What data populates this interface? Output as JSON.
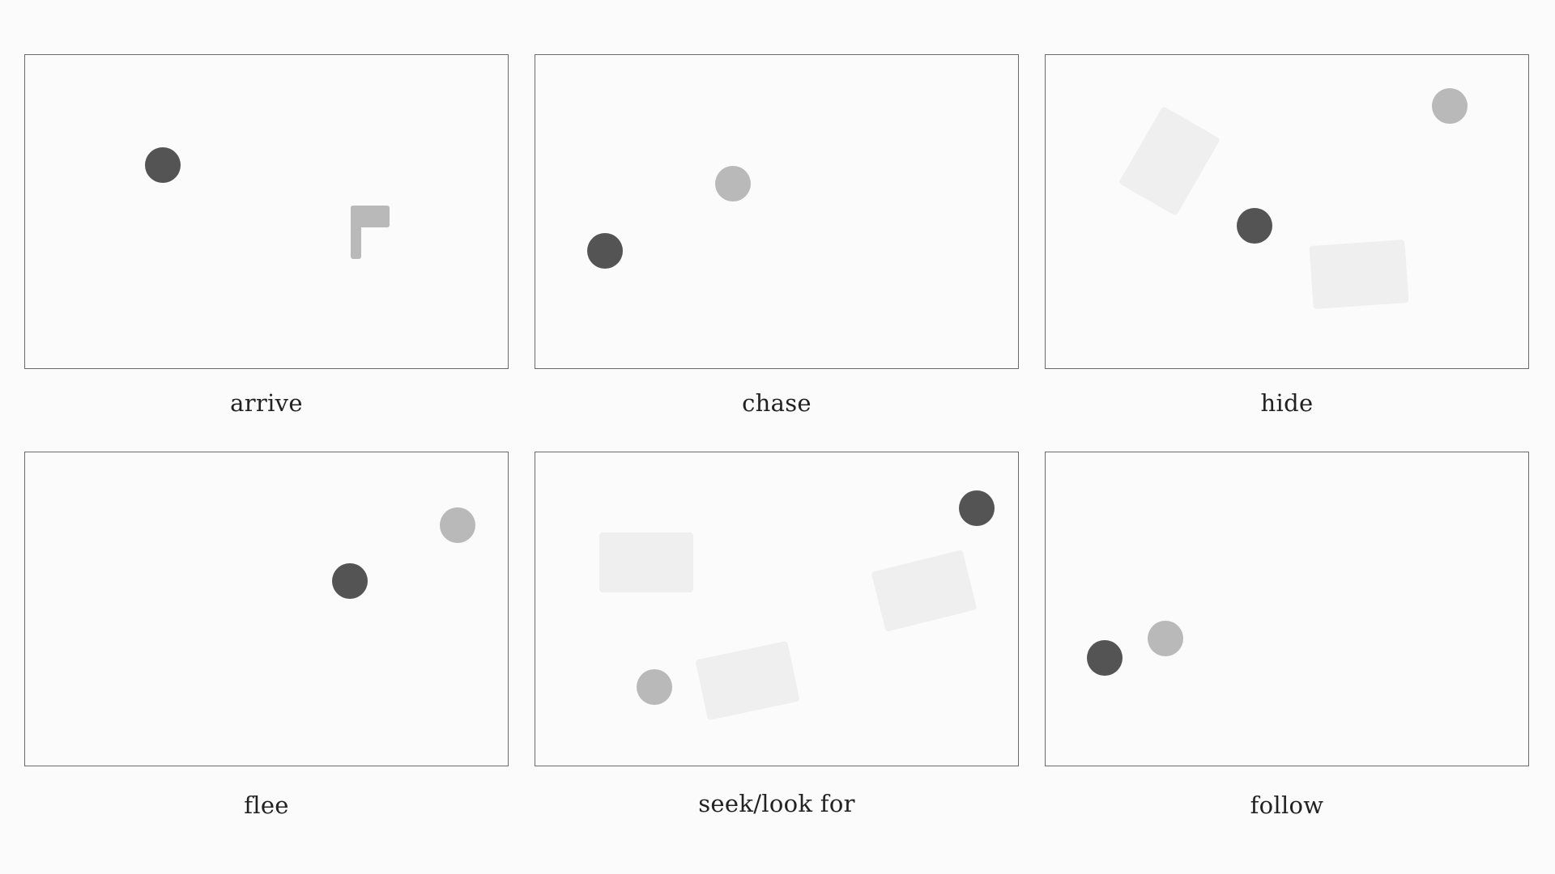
{
  "colors": {
    "agent": "#545454",
    "target": "#b9b9b9",
    "obstacle": "#efefef",
    "border": "#6a6a6a",
    "background": "#fbfbfb",
    "text": "#222222"
  },
  "panels": [
    {
      "id": "arrive",
      "label": "arrive"
    },
    {
      "id": "chase",
      "label": "chase"
    },
    {
      "id": "hide",
      "label": "hide"
    },
    {
      "id": "flee",
      "label": "flee"
    },
    {
      "id": "seek",
      "label": "seek/look for"
    },
    {
      "id": "follow",
      "label": "follow"
    }
  ],
  "icons": {
    "agent": "agent-dot-icon",
    "target": "target-dot-icon",
    "goal": "flag-icon",
    "obstacle": "obstacle-rect"
  }
}
